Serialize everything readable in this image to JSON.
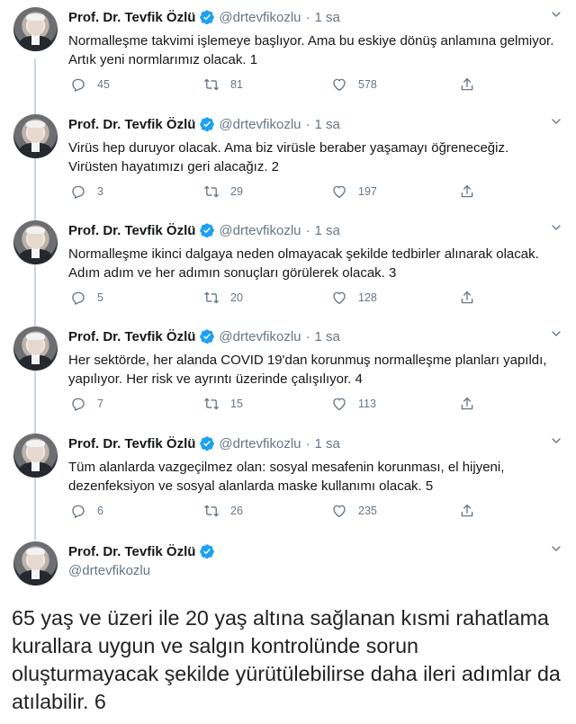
{
  "author": {
    "name": "Prof. Dr. Tevfik Özlü",
    "handle": "@drtevfikozlu",
    "separator": "·"
  },
  "tweets": [
    {
      "time": "1 sa",
      "text": "Normalleşme takvimi işlemeye başlıyor. Ama bu eskiye dönüş anlamına gelmiyor. Artık yeni normlarımız olacak. 1",
      "replies": "45",
      "retweets": "81",
      "likes": "578"
    },
    {
      "time": "1 sa",
      "text": "Virüs hep duruyor olacak. Ama biz virüsle beraber yaşamayı öğreneceğiz. Virüsten hayatımızı geri alacağız. 2",
      "replies": "3",
      "retweets": "29",
      "likes": "197"
    },
    {
      "time": "1 sa",
      "text": "Normalleşme ikinci dalgaya neden olmayacak şekilde tedbirler alınarak olacak. Adım adım ve her adımın sonuçları görülerek olacak. 3",
      "replies": "5",
      "retweets": "20",
      "likes": "128"
    },
    {
      "time": "1 sa",
      "text": "Her sektörde, her alanda COVID 19'dan korunmuş normalleşme planları yapıldı, yapılıyor. Her risk ve ayrıntı üzerinde çalışılıyor. 4",
      "replies": "7",
      "retweets": "15",
      "likes": "113"
    },
    {
      "time": "1 sa",
      "text": "Tüm alanlarda vazgeçilmez olan: sosyal mesafenin korunması, el hijyeni, dezenfeksiyon ve sosyal alanlarda maske kullanımı olacak. 5",
      "replies": "6",
      "retweets": "26",
      "likes": "235"
    }
  ],
  "final_tweet": {
    "text": "65 yaş ve üzeri ile 20 yaş altına sağlanan kısmi rahatlama kurallara uygun ve salgın kontrolünde sorun oluşturmayacak şekilde yürütülebilirse daha ileri adımlar da atılabilir. 6"
  },
  "colors": {
    "text": "#14171a",
    "secondary": "#657786",
    "verified": "#1da1f2",
    "thread_line": "#ccd6dd"
  },
  "icons": [
    "verified-badge-icon",
    "chevron-down-icon",
    "reply-icon",
    "retweet-icon",
    "like-icon",
    "share-icon"
  ]
}
